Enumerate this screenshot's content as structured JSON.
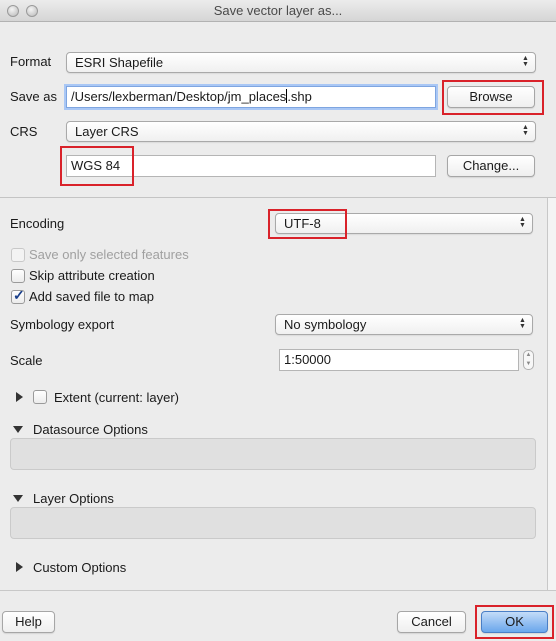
{
  "window": {
    "title": "Save vector layer as..."
  },
  "format": {
    "label": "Format",
    "value": "ESRI Shapefile"
  },
  "save_as": {
    "label": "Save as",
    "value_before_caret": "/Users/lexberman/Desktop/jm_places",
    "value_after_caret": ".shp",
    "browse_label": "Browse"
  },
  "crs": {
    "label": "CRS",
    "value": "Layer CRS",
    "selected_crs": "WGS 84",
    "change_label": "Change..."
  },
  "encoding": {
    "label": "Encoding",
    "value": "UTF-8"
  },
  "options": {
    "save_selected": {
      "label": "Save only selected features",
      "checked": false,
      "enabled": false
    },
    "skip_attributes": {
      "label": "Skip attribute creation",
      "checked": false
    },
    "add_to_map": {
      "label": "Add saved file to map",
      "checked": true
    }
  },
  "symbology": {
    "label": "Symbology export",
    "value": "No symbology"
  },
  "scale": {
    "label": "Scale",
    "value": "1:50000"
  },
  "extent": {
    "label": "Extent (current: layer)",
    "checked": false
  },
  "sections": {
    "datasource": "Datasource Options",
    "layer": "Layer Options",
    "custom": "Custom Options"
  },
  "buttons": {
    "help": "Help",
    "cancel": "Cancel",
    "ok": "OK"
  },
  "colors": {
    "highlight": "#d9222a",
    "default_button": "#6aa6ec"
  }
}
